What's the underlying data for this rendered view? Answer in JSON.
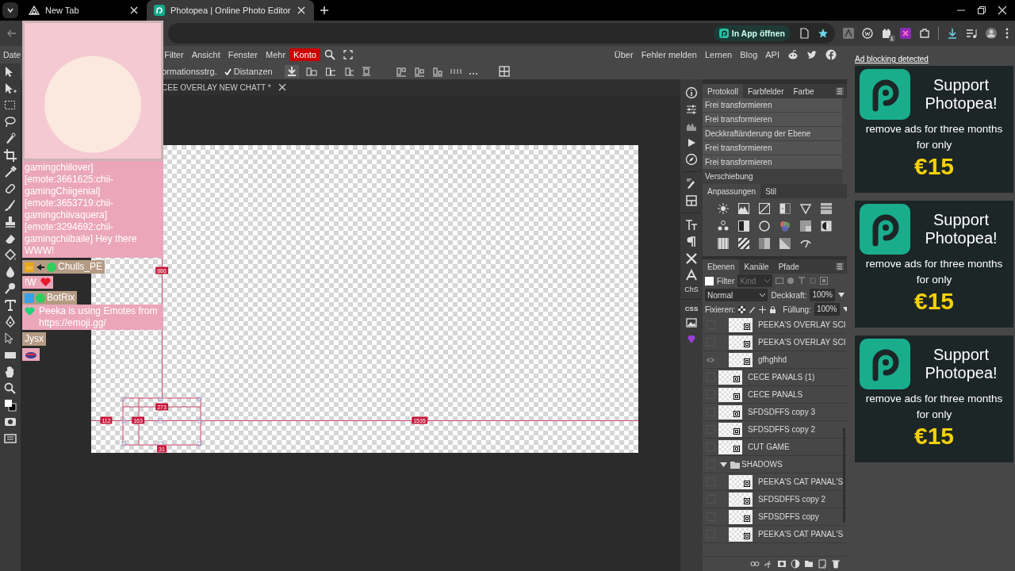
{
  "browser": {
    "tabs": [
      {
        "title": "New Tab",
        "selected": false
      },
      {
        "title": "Photopea | Online Photo Editor",
        "selected": true
      }
    ],
    "open_in_app": "In App öffnen",
    "bookmarked": true,
    "extension_badge": "1"
  },
  "menu": {
    "items": [
      {
        "label": "Date",
        "kind": "menu"
      },
      {
        "label": "Filter",
        "kind": "menu"
      },
      {
        "label": "Ansicht",
        "kind": "menu"
      },
      {
        "label": "Fenster",
        "kind": "menu"
      },
      {
        "label": "Mehr",
        "kind": "menu"
      },
      {
        "label": "Konto",
        "kind": "account"
      }
    ],
    "links": [
      "Über",
      "Fehler melden",
      "Lernen",
      "Blog",
      "API"
    ]
  },
  "options_bar": {
    "label": "ormationsstrg.",
    "distances": {
      "label": "Distanzen",
      "checked": true
    }
  },
  "document_tab": {
    "title": "CEE OVERLAY NEW CHATT",
    "modified": "*"
  },
  "canvas": {
    "measurements": [
      "886",
      "273",
      "112",
      "163",
      "1535",
      "31"
    ]
  },
  "chat_overlay": {
    "messages": [
      {
        "kind": "message",
        "text": "gamingchiilover] [emote:3661625:chii-gamingChiigenial] [emote:3653719:chii-gamingchiivaquera] [emote:3294692:chii-gamingchiibaile] Hey there WWW!"
      },
      {
        "kind": "member",
        "text": "Chulls_PE"
      },
      {
        "kind": "reaction",
        "text": "!W"
      },
      {
        "kind": "bot",
        "text": "BotRix"
      },
      {
        "kind": "notice",
        "text": "Peeka is using Emotes from https://emoji.gg/"
      },
      {
        "kind": "guest",
        "text": "Jysx"
      },
      {
        "kind": "emote"
      }
    ]
  },
  "side_panel": {
    "character_styles": "ChS",
    "css": "CSS"
  },
  "history": {
    "tabs": [
      {
        "label": "Protokoll",
        "selected": true
      },
      {
        "label": "Farbfelder",
        "selected": false
      },
      {
        "label": "Farbe",
        "selected": false
      }
    ],
    "items": [
      {
        "label": "Frei transformieren",
        "selected": false
      },
      {
        "label": "Frei transformieren",
        "selected": false
      },
      {
        "label": "Deckkraftänderung der Ebene",
        "selected": false
      },
      {
        "label": "Frei transformieren",
        "selected": false
      },
      {
        "label": "Frei transformieren",
        "selected": false
      },
      {
        "label": "Verschiebung",
        "selected": true
      }
    ]
  },
  "adjustments": {
    "tabs": [
      {
        "label": "Anpassungen",
        "selected": true
      },
      {
        "label": "Stil",
        "selected": false
      }
    ]
  },
  "layers": {
    "tabs": [
      {
        "label": "Ebenen",
        "selected": true
      },
      {
        "label": "Kanäle",
        "selected": false
      },
      {
        "label": "Pfade",
        "selected": false
      }
    ],
    "filter": {
      "label": "Filter",
      "checked": false
    },
    "kind_filter": "Kind",
    "blend_mode": "Normal",
    "opacity_label": "Deckkraft:",
    "opacity": "100%",
    "lock_label": "Fixieren:",
    "fill_label": "Füllung:",
    "fill": "100%",
    "items": [
      {
        "kind": "group",
        "children": [
          {
            "kind": "layer",
            "name": "PEEKA'S OVERLAY SCI",
            "visible": false
          },
          {
            "kind": "layer",
            "name": "PEEKA'S OVERLAY SCI",
            "visible": false
          },
          {
            "kind": "layer",
            "name": "gfhghhd",
            "visible": true
          }
        ]
      },
      {
        "kind": "layer",
        "name": "CECE PANALS (1)",
        "visible": false
      },
      {
        "kind": "layer",
        "name": "CECE PANALS",
        "visible": false
      },
      {
        "kind": "layer",
        "name": "SFDSDFFS copy 3",
        "visible": false
      },
      {
        "kind": "layer",
        "name": "SFDSDFFS copy 2",
        "visible": false
      },
      {
        "kind": "layer",
        "name": "CUT GAME",
        "visible": false
      },
      {
        "kind": "group",
        "name": "SHADOWS",
        "expanded": true,
        "visible": false,
        "children": [
          {
            "kind": "layer",
            "name": "PEEKA'S CAT PANAL'S",
            "visible": false
          },
          {
            "kind": "layer",
            "name": "SFDSDFFS copy 2",
            "visible": false
          },
          {
            "kind": "layer",
            "name": "SFDSDFFS copy",
            "visible": false
          },
          {
            "kind": "layer",
            "name": "PEEKA'S CAT PANAL'S",
            "visible": false
          }
        ]
      }
    ]
  },
  "ads": {
    "notice": "Ad blocking detected",
    "cards": [
      {
        "title": "Support Photopea!",
        "text": "remove ads for three months for only",
        "price": "€15"
      },
      {
        "title": "Support Photopea!",
        "text": "remove ads for three months for only",
        "price": "€15"
      },
      {
        "title": "Support Photopea!",
        "text": "remove ads for three months for only",
        "price": "€15"
      }
    ]
  }
}
